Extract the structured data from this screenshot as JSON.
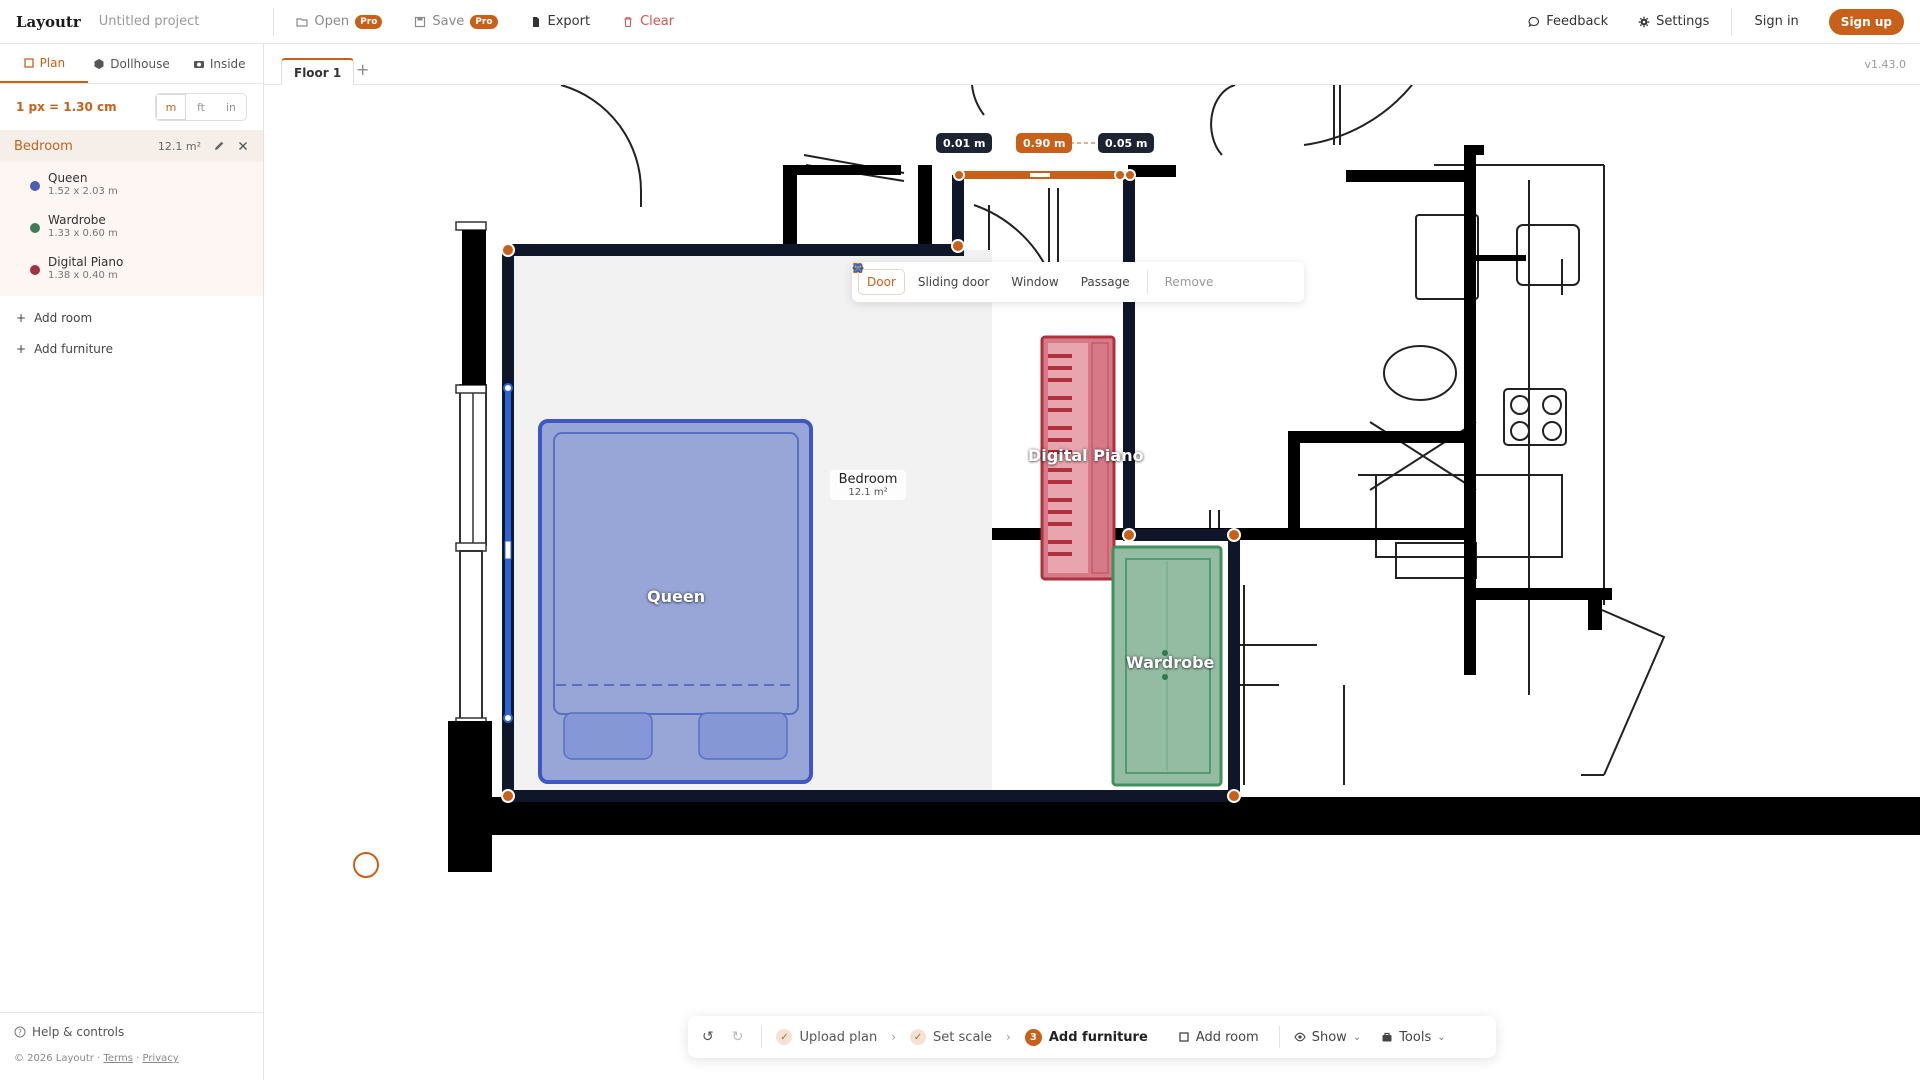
{
  "header": {
    "brand": "Layoutr",
    "project": "Untitled project",
    "open_label": "Open",
    "save_label": "Save",
    "pro_badge": "Pro",
    "export_label": "Export",
    "clear_label": "Clear",
    "feedback_label": "Feedback",
    "settings_label": "Settings",
    "signin_label": "Sign in",
    "signup_label": "Sign up"
  },
  "sidebar": {
    "tabs": [
      {
        "label": "Plan",
        "active": true
      },
      {
        "label": "Dollhouse",
        "active": false
      },
      {
        "label": "Inside",
        "active": false
      }
    ],
    "scale": "1 px = 1.30 cm",
    "units": [
      "m",
      "ft",
      "in"
    ],
    "room": {
      "name": "Bedroom",
      "area": "12.1 m²"
    },
    "items": [
      {
        "name": "Queen",
        "dims": "1.52 x 2.03 m",
        "color": "#4a5fb0"
      },
      {
        "name": "Wardrobe",
        "dims": "1.33 x 0.60 m",
        "color": "#3f7d58"
      },
      {
        "name": "Digital Piano",
        "dims": "1.38 x 0.40 m",
        "color": "#a33240"
      }
    ],
    "add_room": "Add room",
    "add_furniture": "Add furniture",
    "help": "Help & controls",
    "copyright": "© 2026 Layoutr ·",
    "terms": "Terms",
    "privacy": "Privacy"
  },
  "floors": {
    "tab": "Floor 1",
    "add": "+"
  },
  "version": "v1.43.0",
  "canvas": {
    "measure_left": "0.01 m",
    "measure_mid": "0.90 m",
    "measure_right": "0.05 m",
    "opening_menu": {
      "door": "Door",
      "sliding_door": "Sliding door",
      "window": "Window",
      "passage": "Passage",
      "remove": "Remove"
    },
    "room_label": {
      "name": "Bedroom",
      "area": "12.1 m²"
    },
    "furniture": {
      "queen": "Queen",
      "piano": "Digital Piano",
      "wardrobe": "Wardrobe"
    }
  },
  "bottombar": {
    "upload": "Upload plan",
    "scale": "Set scale",
    "step_num": "3",
    "add_furniture": "Add furniture",
    "add_room": "Add room",
    "show": "Show",
    "tools": "Tools"
  },
  "colors": {
    "accent": "#c9601a",
    "wall": "#0f1629",
    "queen_fill": "#97a6d6",
    "piano_fill": "#d67a88",
    "wardrobe_fill": "#94bca3"
  }
}
